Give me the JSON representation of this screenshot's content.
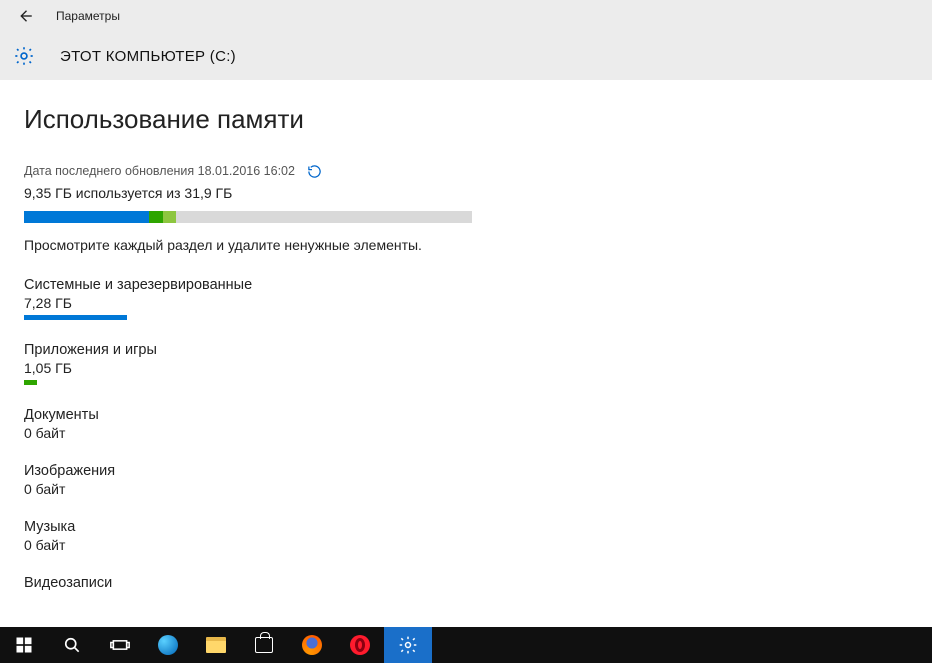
{
  "header": {
    "app_name": "Параметры",
    "drive_title": "ЭТОТ КОМПЬЮТЕР (C:)"
  },
  "page": {
    "title": "Использование памяти",
    "last_update_label": "Дата последнего обновления 18.01.2016 16:02",
    "usage_summary": "9,35 ГБ используется из 31,9 ГБ",
    "hint": "Просмотрите каждый раздел и удалите ненужные элементы."
  },
  "total_bar": {
    "seg1_width": "28%",
    "seg2_width": "3%",
    "seg3_width": "3%"
  },
  "categories": [
    {
      "name": "Системные и зарезервированные",
      "size": "7,28 ГБ",
      "color": "blue",
      "fill": "23%"
    },
    {
      "name": "Приложения и игры",
      "size": "1,05 ГБ",
      "color": "green",
      "fill": "3%"
    },
    {
      "name": "Документы",
      "size": "0 байт",
      "color": "none",
      "fill": "0%"
    },
    {
      "name": "Изображения",
      "size": "0 байт",
      "color": "none",
      "fill": "0%"
    },
    {
      "name": "Музыка",
      "size": "0 байт",
      "color": "none",
      "fill": "0%"
    },
    {
      "name": "Видеозаписи",
      "size": "",
      "color": "none",
      "fill": "0%"
    }
  ],
  "taskbar": {
    "items": [
      "start",
      "search",
      "taskview",
      "edge",
      "explorer",
      "store",
      "firefox",
      "opera",
      "settings"
    ]
  }
}
